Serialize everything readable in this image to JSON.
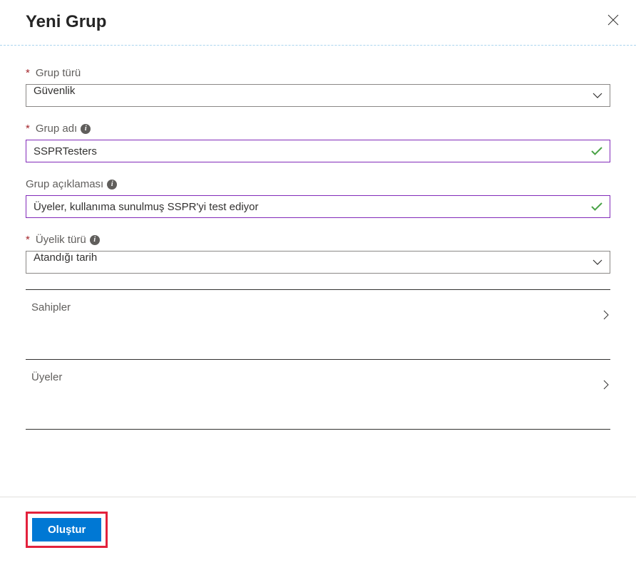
{
  "header": {
    "title": "Yeni Grup"
  },
  "fields": {
    "group_type": {
      "label": "Grup türü",
      "value": "Güvenlik"
    },
    "group_name": {
      "label": "Grup adı",
      "value": "SSPRTesters"
    },
    "group_desc": {
      "label": "Grup açıklaması",
      "value": "Üyeler, kullanıma sunulmuş SSPR'yi test ediyor"
    },
    "membership_type": {
      "label": "Üyelik türü",
      "value": "Atandığı tarih"
    },
    "owners": {
      "label": "Sahipler"
    },
    "members": {
      "label": "Üyeler"
    }
  },
  "footer": {
    "create_label": "Oluştur"
  }
}
